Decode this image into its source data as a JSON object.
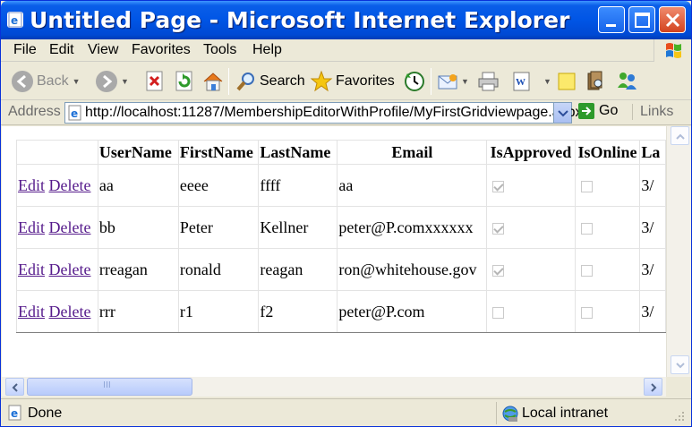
{
  "window": {
    "title": "Untitled Page - Microsoft Internet Explorer"
  },
  "menu": [
    "File",
    "Edit",
    "View",
    "Favorites",
    "Tools",
    "Help"
  ],
  "toolbar": {
    "back_label": "Back",
    "search_label": "Search",
    "favorites_label": "Favorites"
  },
  "address": {
    "label": "Address",
    "url": "http://localhost:11287/MembershipEditorWithProfile/MyFirstGridviewpage.aspx",
    "go_label": "Go",
    "links_label": "Links"
  },
  "grid": {
    "headers": [
      "",
      "UserName",
      "FirstName",
      "LastName",
      "Email",
      "IsApproved",
      "IsOnline",
      "La"
    ],
    "edit_label": "Edit",
    "delete_label": "Delete",
    "rows": [
      {
        "username": "aa",
        "firstname": "eeee",
        "lastname": "ffff",
        "email": "aa",
        "isapproved": true,
        "isonline": false,
        "last": "3/"
      },
      {
        "username": "bb",
        "firstname": "Peter",
        "lastname": "Kellner",
        "email": "peter@P.comxxxxxx",
        "isapproved": true,
        "isonline": false,
        "last": "3/"
      },
      {
        "username": "rreagan",
        "firstname": "ronald",
        "lastname": "reagan",
        "email": "ron@whitehouse.gov",
        "isapproved": true,
        "isonline": false,
        "last": "3/"
      },
      {
        "username": "rrr",
        "firstname": "r1",
        "lastname": "f2",
        "email": "peter@P.com",
        "isapproved": false,
        "isonline": false,
        "last": "3/"
      }
    ]
  },
  "scrollbar": {
    "grip": "III"
  },
  "status": {
    "text": "Done",
    "zone": "Local intranet"
  },
  "colors": {
    "titlebar": "#0055e5",
    "chrome": "#ece9d8",
    "link_visited": "#551a8b"
  }
}
